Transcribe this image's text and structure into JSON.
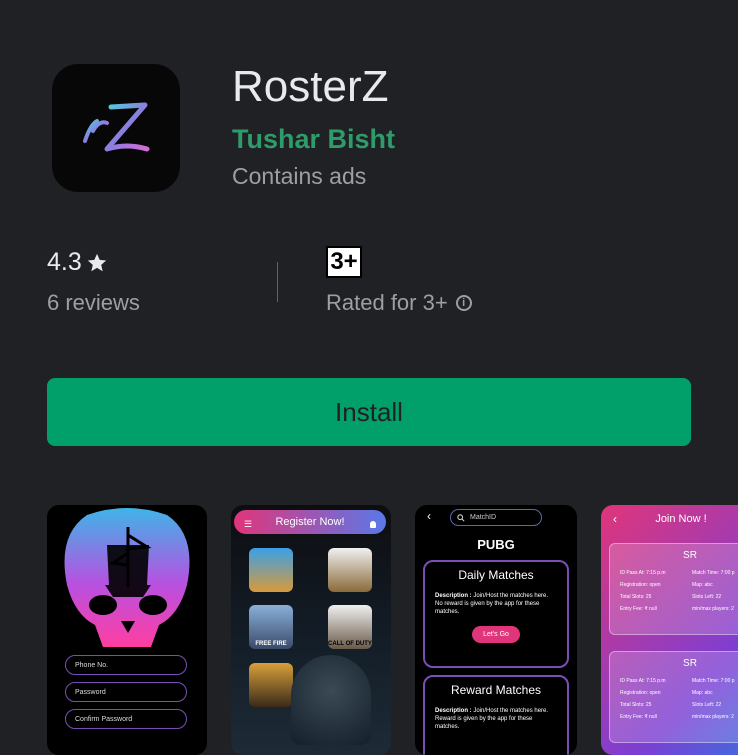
{
  "app": {
    "title": "RosterZ",
    "developer": "Tushar Bisht",
    "ads_notice": "Contains ads",
    "icon": "rz-logo-icon"
  },
  "rating": {
    "value": "4.3",
    "reviews": "6 reviews"
  },
  "content_rating": {
    "badge": "3+",
    "label": "Rated for 3+"
  },
  "install": {
    "label": "Install"
  },
  "colors": {
    "background": "#202124",
    "accent": "#01a06a",
    "developer": "#2e9c6a"
  },
  "screenshots": {
    "shot1": {
      "fields": [
        "Phone No.",
        "Password",
        "Confirm Password"
      ]
    },
    "shot2": {
      "header": "Register Now!",
      "games": [
        "FREE FIRE",
        "CALL OF DUTY"
      ]
    },
    "shot3": {
      "search_placeholder": "MatchID",
      "title": "PUBG",
      "card1": {
        "title": "Daily Matches",
        "desc_label": "Description :",
        "desc_lines": [
          "Join/Host the matches here.",
          "No reward is given by the app for these matches."
        ],
        "button": "Let's Go"
      },
      "card2": {
        "title": "Reward Matches",
        "desc_label": "Description :",
        "desc_lines": [
          "Join/Host the matches here.",
          "Reward is given by the app for these matches."
        ]
      }
    },
    "shot4": {
      "title": "Join Now !",
      "card1": {
        "title": "SR",
        "left": [
          "ID Pass At: 7:15 p.m",
          "Registration: open",
          "Total Slots: 25",
          "Entry Fee: ₹ null"
        ],
        "right": [
          "Match Time: 7:00 p",
          "Map: abc",
          "Slots Left: 22",
          "min/max players: 2"
        ]
      },
      "card2": {
        "title": "SR",
        "left": [
          "ID Pass At: 7:15 p.m",
          "Registration: open",
          "Total Slots: 25",
          "Entry Fee: ₹ null"
        ],
        "right": [
          "Match Time: 7:00 p",
          "Map: abc",
          "Slots Left: 22",
          "min/max players: 2"
        ]
      }
    }
  }
}
